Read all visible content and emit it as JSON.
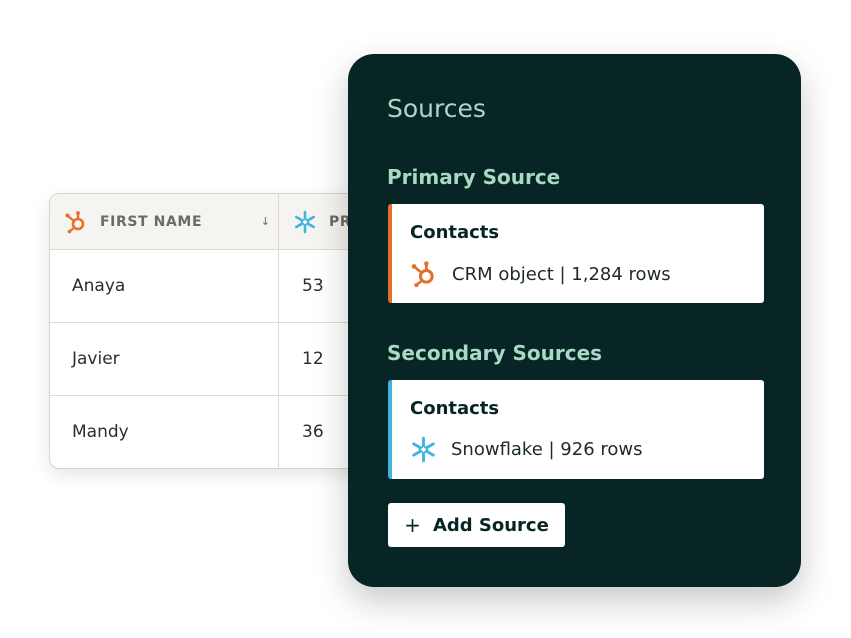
{
  "table": {
    "columns": [
      {
        "label": "FIRST NAME",
        "icon": "hubspot-icon"
      },
      {
        "label": "PR",
        "icon": "snowflake-icon"
      }
    ],
    "sort_indicator": "↓",
    "rows": [
      {
        "first_name": "Anaya",
        "value": "53"
      },
      {
        "first_name": "Javier",
        "value": "12"
      },
      {
        "first_name": "Mandy",
        "value": "36"
      }
    ]
  },
  "panel": {
    "title": "Sources",
    "primary": {
      "heading": "Primary Source",
      "card": {
        "name": "Contacts",
        "icon": "hubspot-icon",
        "meta": "CRM object | 1,284 rows"
      }
    },
    "secondary": {
      "heading": "Secondary Sources",
      "card": {
        "name": "Contacts",
        "icon": "snowflake-icon",
        "meta": "Snowflake | 926 rows"
      }
    },
    "add_button": {
      "plus": "+",
      "label": "Add Source"
    }
  },
  "colors": {
    "panel_bg": "#062524",
    "heading": "#a9d8c4",
    "hubspot_orange": "#e4702a",
    "snowflake_blue": "#3fb4dc"
  }
}
